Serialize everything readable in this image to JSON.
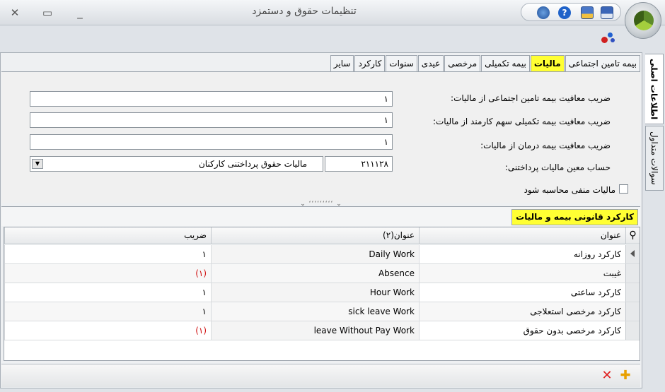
{
  "window": {
    "title": "تنظیمات حقوق و دستمزد"
  },
  "titlebar_icons": [
    "minimize-icon",
    "restore-icon",
    "close-icon",
    "options-icon",
    "help-icon",
    "save-as-icon",
    "save-icon"
  ],
  "tabs": [
    {
      "label": "بیمه تامین اجتماعی",
      "active": false
    },
    {
      "label": "مالیات",
      "active": true
    },
    {
      "label": "بیمه تکمیلی",
      "active": false
    },
    {
      "label": "مرخصی",
      "active": false
    },
    {
      "label": "عیدی",
      "active": false
    },
    {
      "label": "سنوات",
      "active": false
    },
    {
      "label": "کارکرد",
      "active": false
    },
    {
      "label": "سایر",
      "active": false
    }
  ],
  "side_tabs": [
    {
      "label": "اطلاعات اصلی",
      "active": true
    },
    {
      "label": "سوالات متداول",
      "active": false
    }
  ],
  "form": {
    "social_insurance_label": "ضریب معافیت بیمه تامین اجتماعی از مالیات:",
    "social_insurance_value": "۱",
    "supplementary_label": "ضریب معافیت بیمه تکمیلی سهم کارمند از مالیات:",
    "supplementary_value": "۱",
    "medical_label": "ضریب معافیت بیمه درمان از مالیات:",
    "medical_value": "۱",
    "account_label": "حساب معین مالیات پرداختنی:",
    "account_code": "۲۱۱۱۲۸",
    "account_name": "مالیات حقوق پرداختنی کارکنان",
    "negative_tax_label": "مالیات منفی محاسبه شود",
    "negative_tax_checked": false
  },
  "section": {
    "title": "کارکرد قانونی بیمه و مالیات"
  },
  "grid": {
    "columns": [
      "عنوان",
      "عنوان(۲)",
      "ضریب"
    ],
    "rows": [
      {
        "title": "کارکرد روزانه",
        "title2": "Daily Work",
        "coef": "۱",
        "negative": false
      },
      {
        "title": "غیبت",
        "title2": "Absence",
        "coef": "(۱)",
        "negative": true
      },
      {
        "title": "کارکرد ساعتی",
        "title2": "Hour Work",
        "coef": "۱",
        "negative": false
      },
      {
        "title": "کارکرد مرخصی استعلاجی",
        "title2": "sick leave Work",
        "coef": "۱",
        "negative": false
      },
      {
        "title": "کارکرد مرخصی بدون حقوق",
        "title2": "leave Without Pay Work",
        "coef": "(۱)",
        "negative": true
      }
    ]
  },
  "colors": {
    "highlight": "#ffff33",
    "negative": "#d01010",
    "delete": "#e02020",
    "add": "#e8a000"
  }
}
